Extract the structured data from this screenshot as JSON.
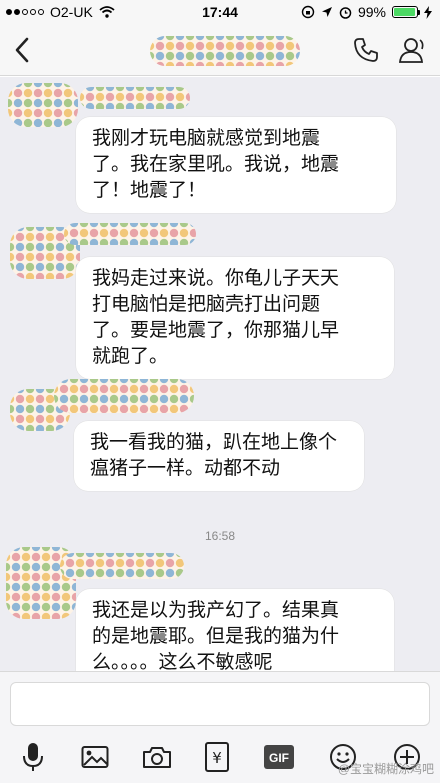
{
  "status_bar": {
    "carrier": "O2-UK",
    "time": "17:44",
    "battery": "99%"
  },
  "messages": [
    {
      "lines": [
        "我刚才玩电脑就感觉到地震",
        "了。我在家里吼。我说，地震",
        "了！地震了！"
      ]
    },
    {
      "lines": [
        "我妈走过来说。你龟儿子天天",
        "打电脑怕是把脑壳打出问题",
        "了。要是地震了，你那猫儿早",
        "就跑了。"
      ]
    },
    {
      "lines": [
        "我一看我的猫，趴在地上像个",
        "瘟猪子一样。动都不动"
      ]
    },
    {
      "lines": [
        "我还是以为我产幻了。结果真",
        "的是地震耶。但是我的猫为什",
        "么。。。。这么不敏感呢"
      ]
    }
  ],
  "timestamp": "16:58",
  "toolbar": {
    "icons": [
      "microphone-icon",
      "image-icon",
      "camera-icon",
      "red-packet-icon",
      "gif-icon",
      "emoji-icon",
      "plus-icon"
    ],
    "gif_label": "GIF",
    "yen_symbol": "¥"
  },
  "watermark": "@宝宝糊糊涂鸡吧"
}
